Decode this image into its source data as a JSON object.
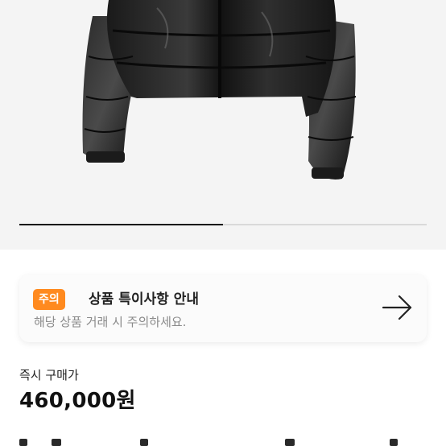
{
  "product": {
    "image_icon": "puffer-jacket-photo",
    "carousel": {
      "current_slide": 1,
      "progress_fraction": 0.5
    }
  },
  "notice": {
    "badge": "주의",
    "title": "상품 특이사항 안내",
    "subtitle": "해당 상품 거래 시 주의하세요.",
    "arrow_icon": "arrow-right-icon",
    "badge_color": "#ff8a1f"
  },
  "price": {
    "label": "즉시 구매가",
    "value": "460,000원"
  }
}
